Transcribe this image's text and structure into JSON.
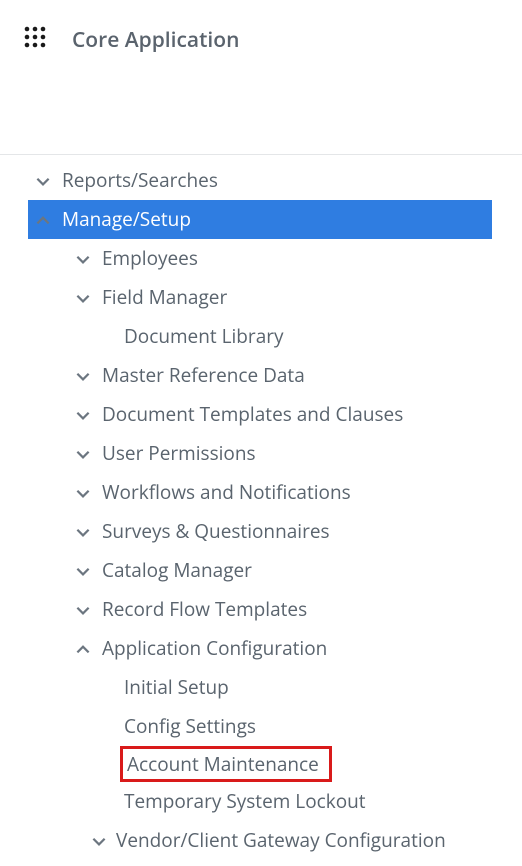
{
  "header": {
    "title": "Core Application"
  },
  "nav": {
    "items": [
      {
        "label": "Reports/Searches",
        "level": 0,
        "expanded": false
      },
      {
        "label": "Manage/Setup",
        "level": 0,
        "expanded": true,
        "selected": true
      },
      {
        "label": "Employees",
        "level": 1,
        "expanded": false
      },
      {
        "label": "Field Manager",
        "level": 1,
        "expanded": false
      },
      {
        "label": "Document Library",
        "level": 1,
        "leaf": true
      },
      {
        "label": "Master Reference Data",
        "level": 1,
        "expanded": false
      },
      {
        "label": "Document Templates and Clauses",
        "level": 1,
        "expanded": false
      },
      {
        "label": "User Permissions",
        "level": 1,
        "expanded": false
      },
      {
        "label": "Workflows and Notifications",
        "level": 1,
        "expanded": false
      },
      {
        "label": "Surveys & Questionnaires",
        "level": 1,
        "expanded": false
      },
      {
        "label": "Catalog Manager",
        "level": 1,
        "expanded": false
      },
      {
        "label": "Record Flow Templates",
        "level": 1,
        "expanded": false
      },
      {
        "label": "Application Configuration",
        "level": 1,
        "expanded": true
      },
      {
        "label": "Initial Setup",
        "level": 2,
        "leaf": true
      },
      {
        "label": "Config Settings",
        "level": 2,
        "leaf": true
      },
      {
        "label": "Account Maintenance",
        "level": 2,
        "leaf": true,
        "highlighted": true
      },
      {
        "label": "Temporary System Lockout",
        "level": 2,
        "leaf": true
      },
      {
        "label": "Vendor/Client Gateway Configuration",
        "level": 2,
        "expanded": false
      }
    ]
  }
}
